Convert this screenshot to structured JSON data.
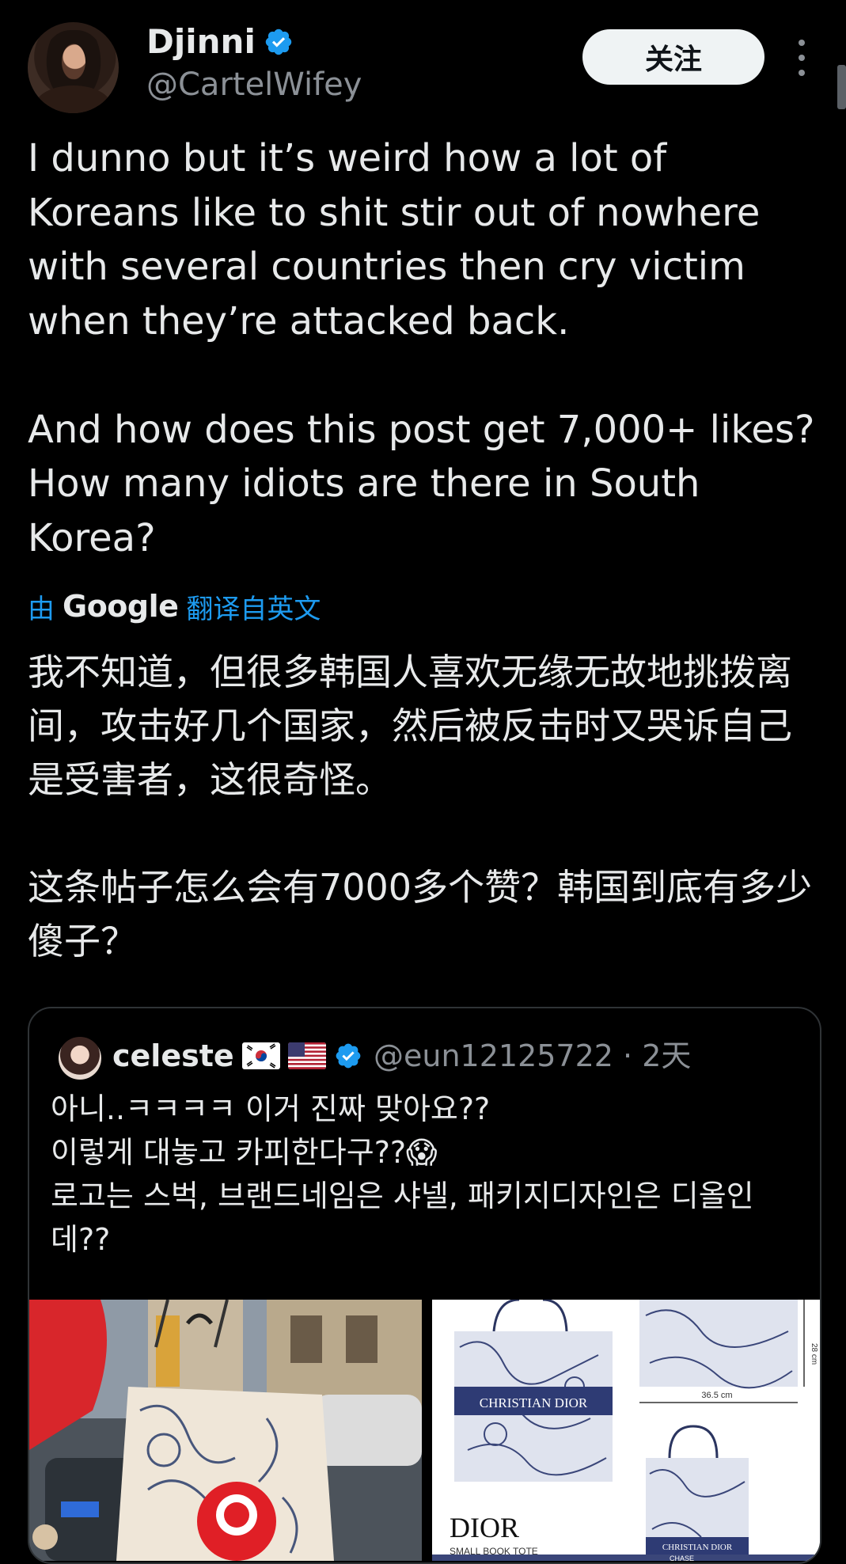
{
  "author": {
    "name": "Djinni",
    "handle": "@CartelWifey",
    "follow_label": "关注"
  },
  "tweet": {
    "text": "I dunno but it’s weird how a lot of Koreans like to shit stir out of nowhere with several countries then cry victim when they’re attacked back.\n\nAnd how does this post get 7,000+ likes? How many idiots are there in South Korea?"
  },
  "translation": {
    "prefix": "由",
    "provider": "Google",
    "suffix": "翻译自英文",
    "text": "我不知道，但很多韩国人喜欢无缘无故地挑拨离间，攻击好几个国家，然后被反击时又哭诉自己是受害者，这很奇怪。\n\n这条帖子怎么会有7000多个赞？韩国到底有多少傻子？"
  },
  "quote": {
    "name": "celeste",
    "handle_time": "@eun12125722 · 2天",
    "text": "아니..ㅋㅋㅋㅋ 이거 진짜 맞아요??\n이렇게 대놓고 카피한다구??😱\n로고는 스벅, 브랜드네임은 샤넬, 패키지디자인은 디올인데??",
    "media_right": {
      "bag_label": "CHRISTIAN DIOR",
      "brand": "DIOR",
      "caption": "SMALL BOOK TOTE",
      "dim_width": "36.5 cm",
      "dim_height": "28 cm",
      "bag_label_small": "CHRISTIAN DIOR",
      "bottom_label": "CHASE"
    }
  },
  "colors": {
    "background": "#000000",
    "text": "#e7e9ea",
    "secondary": "#8b9096",
    "accent": "#1d9bf0",
    "border": "#2f3336"
  }
}
